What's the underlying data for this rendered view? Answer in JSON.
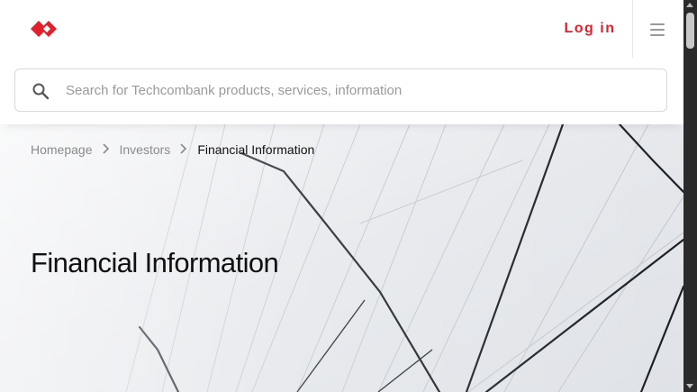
{
  "header": {
    "logo_icon": "techcombank-logo-icon",
    "brand_color": "#e0202a",
    "login_label": "Log in",
    "menu_icon": "hamburger-menu-icon"
  },
  "search": {
    "icon": "search-icon",
    "placeholder": "Search for Techcombank products, services, information",
    "value": ""
  },
  "breadcrumb": {
    "items": [
      {
        "label": "Homepage"
      },
      {
        "label": "Investors"
      },
      {
        "label": "Financial Information"
      }
    ],
    "separator_icon": "chevron-right-icon"
  },
  "hero": {
    "title": "Financial Information"
  }
}
